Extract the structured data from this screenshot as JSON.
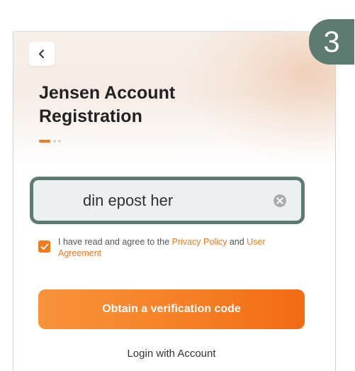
{
  "header": {
    "back_icon": "chevron-left-icon",
    "title": "Jensen Account Registration",
    "step_indicator": {
      "total": 3,
      "current": 1
    }
  },
  "email_input": {
    "value": "din epost her",
    "clear_icon": "clear-circle-icon"
  },
  "agreement": {
    "checked": true,
    "text_prefix": "I have read and agree to the ",
    "privacy_link": "Privacy Policy",
    "text_middle": " and ",
    "user_agreement_link": "User Agreement"
  },
  "actions": {
    "primary_label": "Obtain a verification code",
    "secondary_label": "Login with Account"
  },
  "step_badge": {
    "label": "3"
  },
  "colors": {
    "accent": "#f07a1c",
    "highlight_frame": "#5d7b70"
  }
}
